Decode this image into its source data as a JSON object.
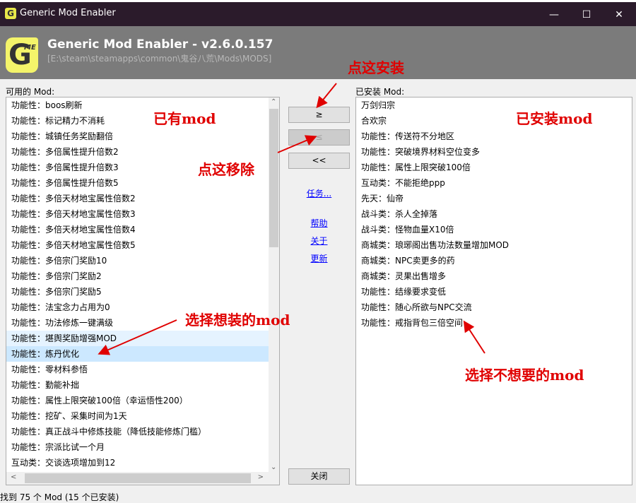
{
  "window": {
    "title": "Generic Mod Enabler",
    "logo": "G",
    "minimize_icon": "minimize-icon",
    "maximize_icon": "maximize-icon",
    "close_icon": "close-icon"
  },
  "header": {
    "title": "Generic Mod Enabler - v2.6.0.157",
    "path": "[E:\\steam\\steamapps\\common\\鬼谷八荒\\Mods\\MODS]",
    "logo": "GME"
  },
  "available": {
    "label": "可用的 Mod:",
    "items": [
      "功能性：boos刷新",
      "功能性：标记精力不消耗",
      "功能性：城镇任务奖励翻倍",
      "功能性：多倍属性提升倍数2",
      "功能性：多倍属性提升倍数3",
      "功能性：多倍属性提升倍数5",
      "功能性：多倍天材地宝属性倍数2",
      "功能性：多倍天材地宝属性倍数3",
      "功能性：多倍天材地宝属性倍数4",
      "功能性：多倍天材地宝属性倍数5",
      "功能性：多倍宗门奖励10",
      "功能性：多倍宗门奖励2",
      "功能性：多倍宗门奖励5",
      "功能性：法宝念力占用为0",
      "功能性：功法修炼一键满级",
      "功能性：堪舆奖励增强MOD",
      "功能性：炼丹优化",
      "功能性：零材料参悟",
      "功能性：勤能补拙",
      "功能性：属性上限突破100倍（幸运悟性200）",
      "功能性：挖矿、采集时间为1天",
      "功能性：真正战斗中修炼技能（降低技能修炼门槛）",
      "功能性：宗派比试一个月",
      "互动类：交谈选项增加到12"
    ],
    "hover_index": 15,
    "selected_index": 16
  },
  "installed": {
    "label": "已安装 Mod:",
    "items": [
      "万剑归宗",
      "合欢宗",
      "功能性：传送符不分地区",
      "功能性：突破境界材料空位变多",
      "功能性：属性上限突破100倍",
      "互动类：不能拒绝ppp",
      "先天：仙帝",
      "战斗类：杀人全掉落",
      "战斗类：怪物血量X10倍",
      "商城类：琅琊阁出售功法数量增加MOD",
      "商城类：NPC卖更多的药",
      "商城类：灵果出售增多",
      "功能性：结缘要求变低",
      "功能性：随心所欲与NPC交流",
      "功能性：戒指背包三倍空间"
    ]
  },
  "buttons": {
    "install": "≥",
    "remove": "≤",
    "remove_all": "<<",
    "close": "关闭"
  },
  "links": {
    "tasks": "任务...",
    "help": "帮助",
    "about": "关于",
    "update": "更新"
  },
  "status": "找到 75 个 Mod (15 个已安装)",
  "annotations": {
    "install": "点这安装",
    "remove": "点这移除",
    "have": "已有mod",
    "installed": "已安装mod",
    "choose": "选择想装的mod",
    "choose_remove": "选择不想要的mod",
    "color": "#e00000"
  }
}
